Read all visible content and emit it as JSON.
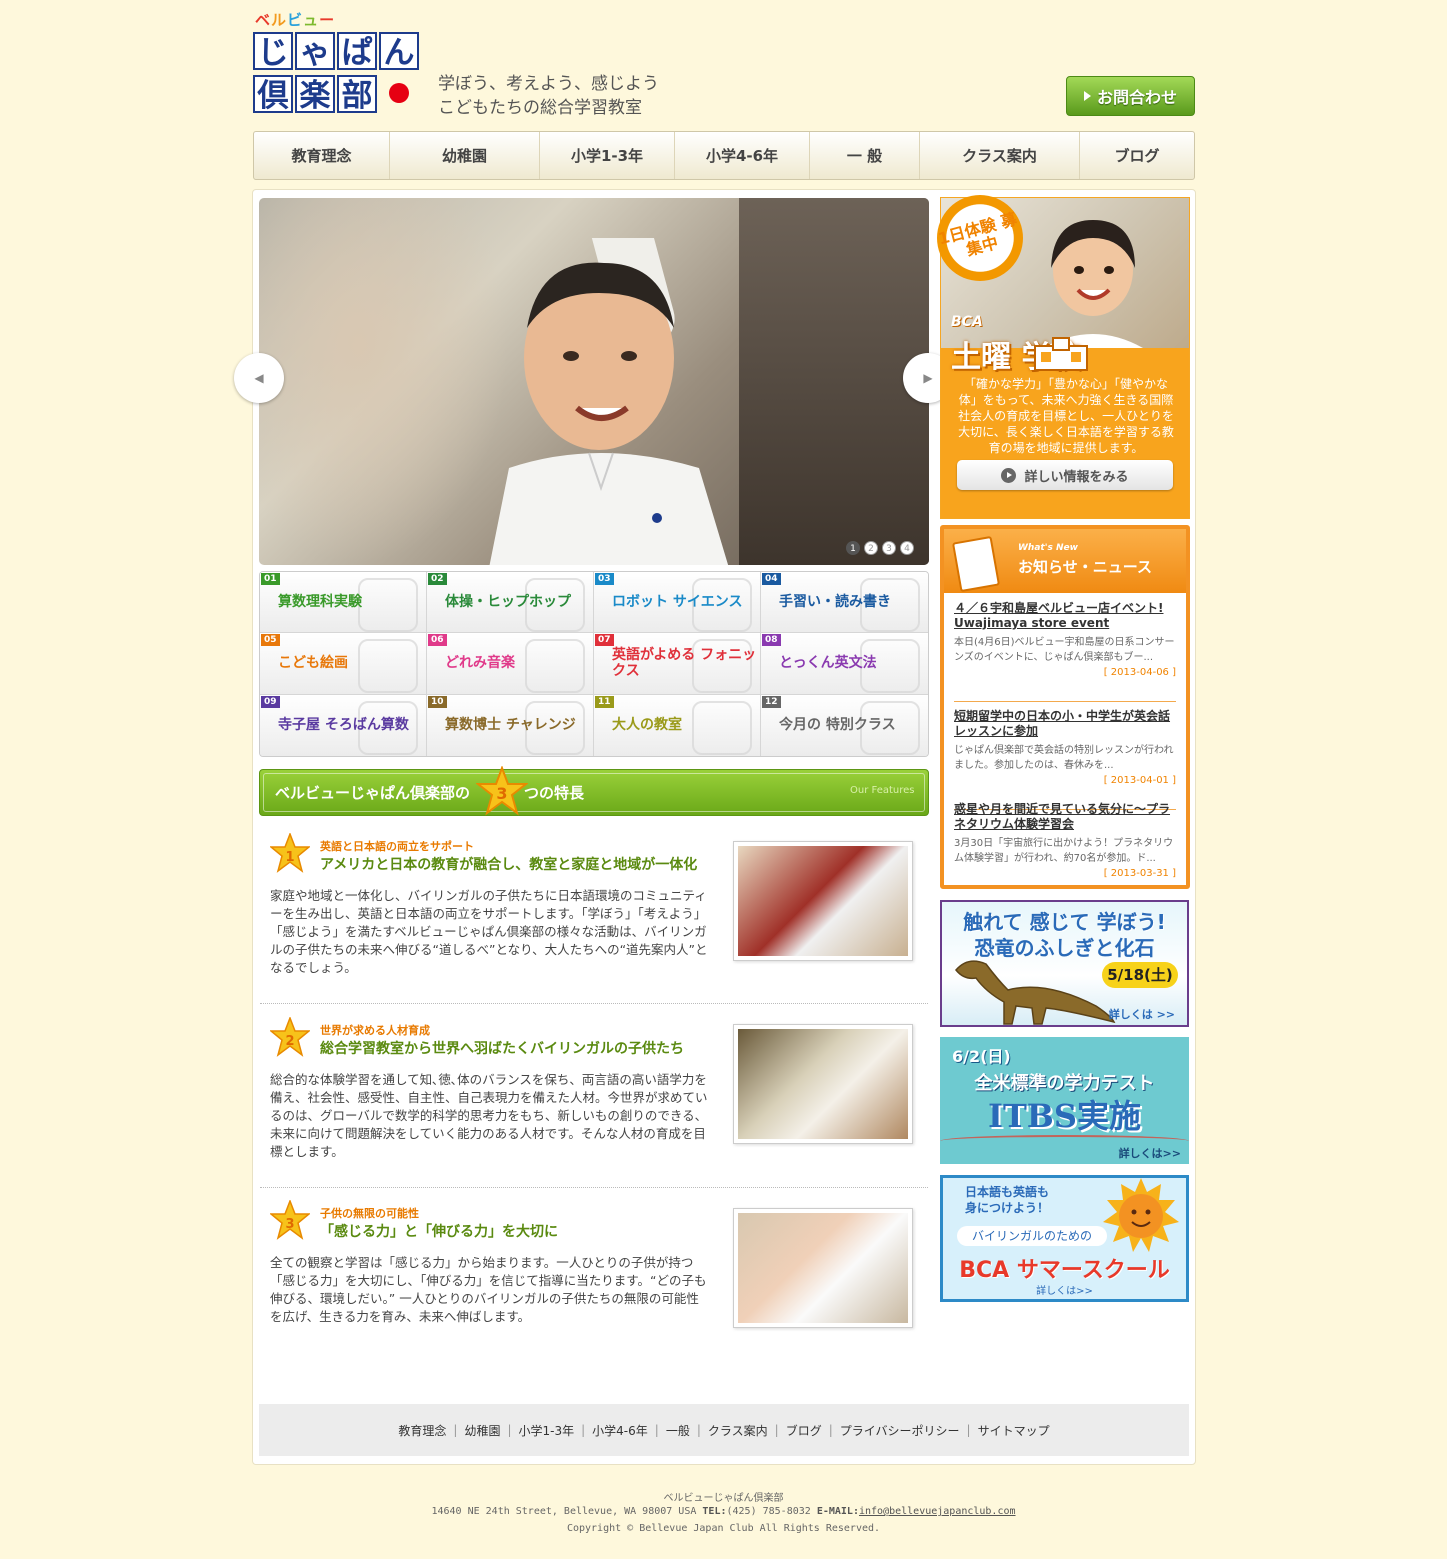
{
  "header": {
    "logo_small": [
      "ベ",
      "ル",
      "ビ",
      "ュ",
      "ー"
    ],
    "logo_row1": [
      "じ",
      "ゃ",
      "ぱ",
      "ん"
    ],
    "logo_row2": [
      "倶",
      "楽",
      "部"
    ],
    "tagline1": "学ぼう、考えよう、感じよう",
    "tagline2": "こどもたちの総合学習教室",
    "contact_label": "お問合わせ"
  },
  "nav": [
    "教育理念",
    "幼稚園",
    "小学1-3年",
    "小学4-6年",
    "一 般",
    "クラス案内",
    "ブログ"
  ],
  "slider": {
    "prev_label": "◀",
    "next_label": "▶",
    "dots": [
      "1",
      "2",
      "3",
      "4"
    ],
    "active_dot": 1
  },
  "classes": [
    {
      "num": "01",
      "label": "算数理科実験",
      "color": "#3a9a2a"
    },
    {
      "num": "02",
      "label": "体操・ヒップホップ",
      "color": "#2a8a3a"
    },
    {
      "num": "03",
      "label": "ロボット サイエンス",
      "color": "#1a8ac8"
    },
    {
      "num": "04",
      "label": "手習い・読み書き",
      "color": "#1a5aa0"
    },
    {
      "num": "05",
      "label": "こども絵画",
      "color": "#e8780a"
    },
    {
      "num": "06",
      "label": "どれみ音楽",
      "color": "#e03a8a"
    },
    {
      "num": "07",
      "label": "英語がよめる フォニックス",
      "color": "#e0303a"
    },
    {
      "num": "08",
      "label": "とっくん英文法",
      "color": "#8a3ab0"
    },
    {
      "num": "09",
      "label": "寺子屋 そろばん算数",
      "color": "#5a3aa0"
    },
    {
      "num": "10",
      "label": "算数博士 チャレンジ",
      "color": "#8a6a2a"
    },
    {
      "num": "11",
      "label": "大人の教室",
      "color": "#9a9a1a"
    },
    {
      "num": "12",
      "label": "今月の 特別クラス",
      "color": "#666666"
    }
  ],
  "features": {
    "heading_before": "ベルビューじゃぱん倶楽部の",
    "heading_num": "3",
    "heading_after": "つの特長",
    "heading_en": "Our Features",
    "items": [
      {
        "num": "1",
        "sub": "英語と日本語の両立をサポート",
        "title": "アメリカと日本の教育が融合し、教室と家庭と地域が一体化",
        "body": "家庭や地域と一体化し、バイリンガルの子供たちに日本語環境のコミュニティーを生み出し、英語と日本語の両立をサポートします。「学ぼう」「考えよう」「感じよう」を満たすベルビューじゃぱん倶楽部の様々な活動は、バイリンガルの子供たちの未来へ伸びる“道しるべ”となり、大人たちへの“道先案内人”となるでしょう。"
      },
      {
        "num": "2",
        "sub": "世界が求める人材育成",
        "title": "総合学習教室から世界へ羽ばたくバイリンガルの子供たち",
        "body": "総合的な体験学習を通して知､徳､体のバランスを保ち、両言語の高い語学力を備え、社会性、感受性、自主性、自己表現力を備えた人材。今世界が求めているのは、グローバルで数学的科学的思考力をもち、新しいもの創りのできる、未来に向けて問題解決をしていく能力のある人材です。そんな人材の育成を目標とします。"
      },
      {
        "num": "3",
        "sub": "子供の無限の可能性",
        "title": "「感じる力」と「伸びる力」を大切に",
        "body": "全ての観察と学習は「感じる力」から始まります。一人ひとりの子供が持つ「感じる力」を大切にし、「伸びる力」を信じて指導に当たります。“どの子も伸びる、環境しだい。” 一人ひとりのバイリンガルの子供たちの無限の可能性を広げ、生きる力を育み、未来へ伸ばします。"
      }
    ]
  },
  "saturday": {
    "badge": "1日体験 募集中",
    "bca": "BCA",
    "title": "土曜  学校",
    "desc": "「確かな学力」「豊かな心」「健やかな体」をもって、未来へ力強く生きる国際社会人の育成を目標とし、一人ひとりを大切に、長く楽しく日本語を学習する教育の場を地域に提供します。",
    "button": "詳しい情報をみる"
  },
  "news": {
    "heading_en": "What's New",
    "heading_ja": "お知らせ・ニュース",
    "items": [
      {
        "title": "４／６宇和島屋ベルビュー店イベント! Uwajimaya store event",
        "text": "本日(4月6日)ベルビュー宇和島屋の日系コンサーンズのイベントに、じゃぱん倶楽部もブー...",
        "date": "[ 2013-04-06 ]"
      },
      {
        "title": "短期留学中の日本の小・中学生が英会話レッスンに参加",
        "text": "じゃぱん倶楽部で英会話の特別レッスンが行われました。参加したのは、春休みを...",
        "date": "[ 2013-04-01 ]"
      },
      {
        "title": "惑星や月を間近で見ている気分に〜プラネタリウム体験学習会",
        "text": "3月30日「宇宙旅行に出かけよう！プラネタリウム体験学習」が行われ、約70名が参加。ド...",
        "date": "[ 2013-03-31 ]"
      }
    ]
  },
  "banners": {
    "dino_title1": "触れて 感じて 学ぼう!",
    "dino_title2": "恐竜のふしぎと化石",
    "dino_date": "5/18(土)",
    "dino_more": "詳しくは >>",
    "itbs_date": "6/2(日)",
    "itbs_line1": "全米標準の学力テスト",
    "itbs_line2": "ITBS実施",
    "itbs_more": "詳しくは>>",
    "summer_line1": "日本語も英語も",
    "summer_line2": "身につけよう！",
    "summer_line3": "バイリンガルのための",
    "summer_title": "BCA サマースクール",
    "summer_more": "詳しくは>>"
  },
  "footer": {
    "links": [
      "教育理念",
      "幼稚園",
      "小学1-3年",
      "小学4-6年",
      "一般",
      "クラス案内",
      "ブログ",
      "プライバシーポリシー",
      "サイトマップ"
    ],
    "name": "ベルビューじゃぱん倶楽部",
    "address": "14640 NE 24th Street, Bellevue, WA 98007 USA",
    "tel_label": "TEL:",
    "tel": "(425) 785-8032",
    "email_label": "E-MAIL:",
    "email": "info@bellevuejapanclub.com",
    "copyright": "Copyright © Bellevue Japan Club All Rights Reserved."
  },
  "colors": {
    "background": "#fef8dc",
    "accent_green": "#6aa818",
    "accent_orange": "#f39222",
    "logo_blue": "#1d3b8c"
  }
}
